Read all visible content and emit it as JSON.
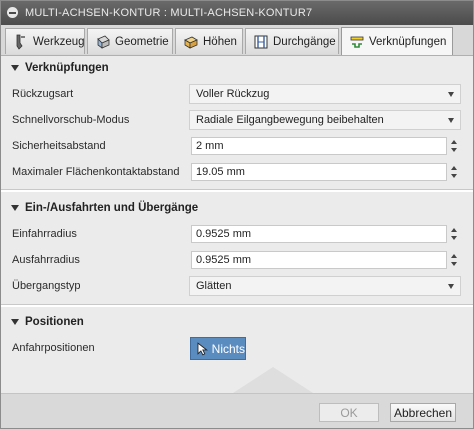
{
  "window": {
    "title": "MULTI-ACHSEN-KONTUR : MULTI-ACHSEN-KONTUR7"
  },
  "tabs": [
    {
      "label": "Werkzeug",
      "icon": "tool-icon"
    },
    {
      "label": "Geometrie",
      "icon": "geometry-icon"
    },
    {
      "label": "Höhen",
      "icon": "heights-icon"
    },
    {
      "label": "Durchgänge",
      "icon": "passes-icon"
    },
    {
      "label": "Verknüpfungen",
      "icon": "linking-icon",
      "active": true
    }
  ],
  "sections": {
    "linking": {
      "title": "Verknüpfungen",
      "retract_label": "Rückzugsart",
      "retract_value": "Voller Rückzug",
      "rapid_label": "Schnellvorschub-Modus",
      "rapid_value": "Radiale Eilgangbewegung beibehalten",
      "safe_label": "Sicherheitsabstand",
      "safe_value": "2 mm",
      "maxcontact_label": "Maximaler Flächenkontaktabstand",
      "maxcontact_value": "19.05 mm"
    },
    "leads": {
      "title": "Ein-/Ausfahrten und Übergänge",
      "entry_label": "Einfahrradius",
      "entry_value": "0.9525 mm",
      "exit_label": "Ausfahrradius",
      "exit_value": "0.9525 mm",
      "transition_label": "Übergangstyp",
      "transition_value": "Glätten"
    },
    "positions": {
      "title": "Positionen",
      "approach_label": "Anfahrpositionen",
      "approach_button": "Nichts"
    }
  },
  "footer": {
    "ok": "OK",
    "cancel": "Abbrechen"
  },
  "colors": {
    "accent": "#5b8cc0",
    "titlebar": "#555555",
    "panel": "#ebebeb"
  }
}
